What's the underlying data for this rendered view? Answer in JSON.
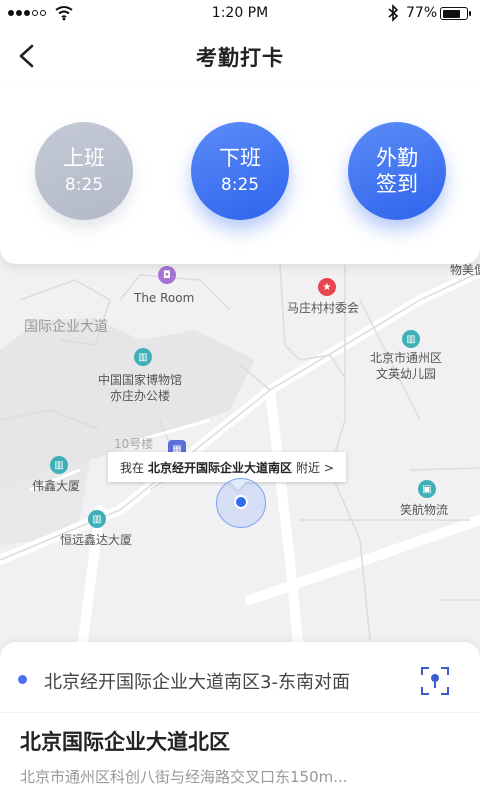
{
  "status_bar": {
    "time": "1:20 PM",
    "battery_percent": "77%",
    "battery_level": 0.77,
    "signal_icon": "signal-dots-icon",
    "wifi_icon": "wifi-icon",
    "bluetooth_icon": "bluetooth-icon"
  },
  "header": {
    "back_icon": "chevron-left-icon",
    "title": "考勤打卡"
  },
  "punch": {
    "clock_in": {
      "label": "上班",
      "time": "8:25",
      "color": "#b8bdcc"
    },
    "clock_out": {
      "label": "下班",
      "time": "8:25",
      "color": "#3d72f0"
    },
    "field_checkin": {
      "label_line1": "外勤",
      "label_line2": "签到",
      "color": "#3d72f0"
    }
  },
  "map": {
    "pois": [
      {
        "name": "The Room"
      },
      {
        "name": "马庄村村委会"
      },
      {
        "name": "物美便利超"
      },
      {
        "name": "北京市通州区",
        "name2": "文英幼儿园"
      },
      {
        "name": "中国国家博物馆",
        "name2": "亦庄办公楼"
      },
      {
        "name": "伟鑫大厦"
      },
      {
        "name": "恒远鑫达大厦"
      },
      {
        "name": "笑航物流"
      }
    ],
    "district_label": "国际企业大道",
    "building_label": "10号楼",
    "tooltip": {
      "prefix": "我在",
      "location": "北京经开国际企业大道南区",
      "suffix": "附近 >"
    },
    "location_color": "#2f6df0"
  },
  "bottom": {
    "current_address": "北京经开国际企业大道南区3-东南对面",
    "scan_icon": "location-scan-icon",
    "place_name": "北京国际企业大道北区",
    "place_address": "北京市通州区科创八街与经海路交叉口东150m..."
  }
}
